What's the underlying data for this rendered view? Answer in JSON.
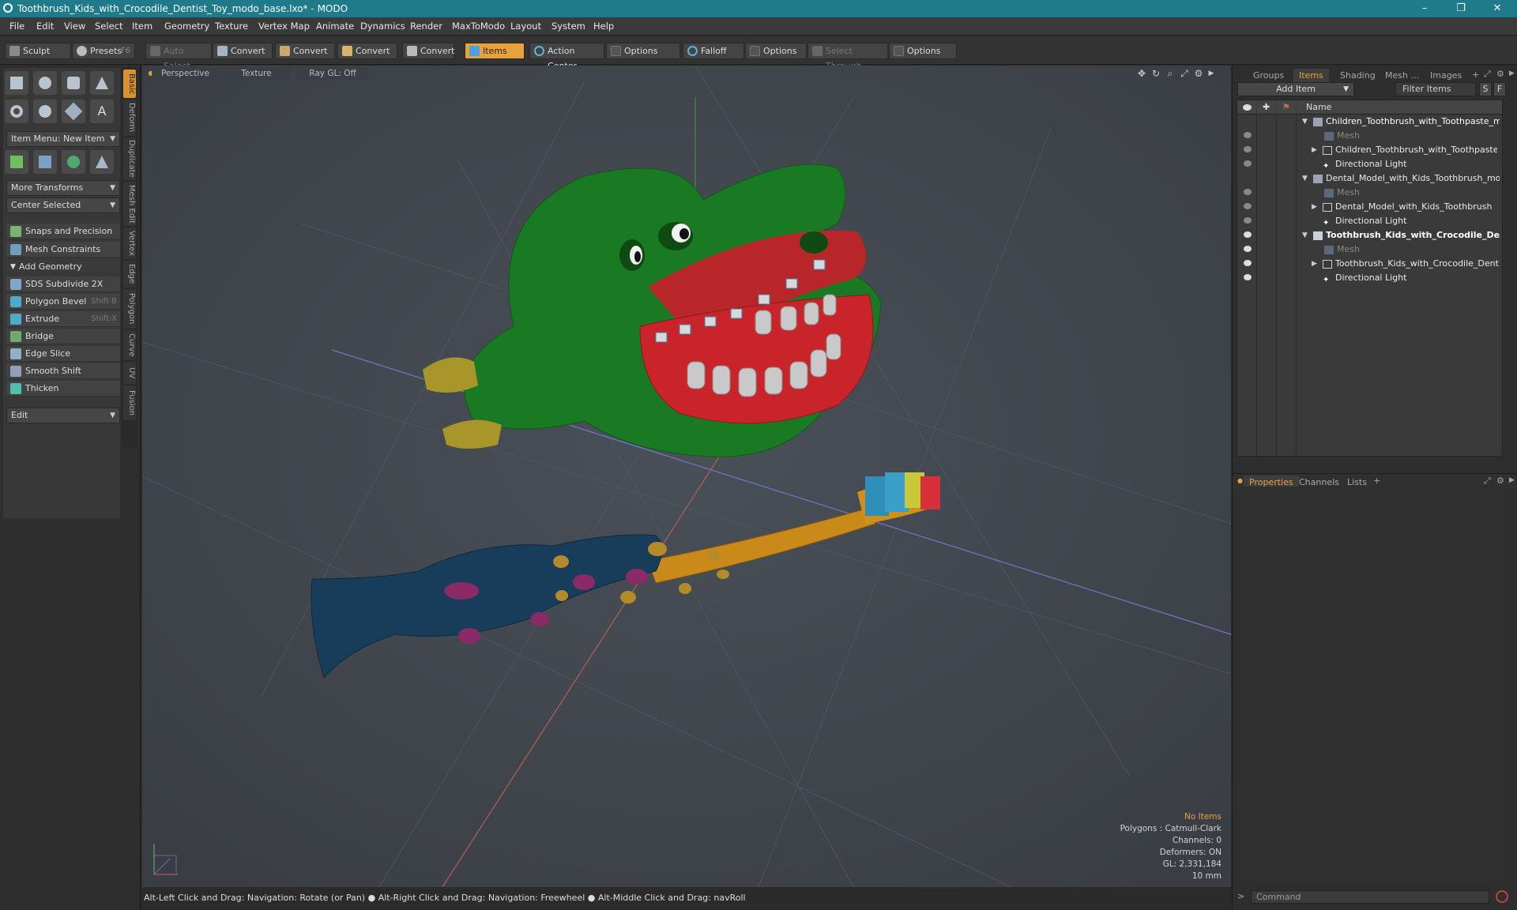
{
  "window": {
    "title": "Toothbrush_Kids_with_Crocodile_Dentist_Toy_modo_base.lxo* - MODO",
    "minimize": "–",
    "maximize": "❐",
    "close": "✕"
  },
  "menu": [
    "File",
    "Edit",
    "View",
    "Select",
    "Item",
    "Geometry",
    "Texture",
    "Vertex Map",
    "Animate",
    "Dynamics",
    "Render",
    "MaxToModo",
    "Layout",
    "System",
    "Help"
  ],
  "toolbar": {
    "sculpt": "Sculpt",
    "presets": "Presets",
    "presets_shortcut": "F6",
    "auto_select": "Auto Select",
    "convert1": "Convert",
    "convert2": "Convert",
    "convert3": "Convert",
    "convert4": "Convert",
    "items": "Items",
    "action_center": "Action Center",
    "options1": "Options",
    "falloff": "Falloff",
    "options2": "Options",
    "select_through": "Select Through",
    "options3": "Options"
  },
  "left": {
    "item_menu": "Item Menu: New Item",
    "more_transforms": "More Transforms",
    "center_selected": "Center Selected",
    "snaps": "Snaps and Precision",
    "mesh_constraints": "Mesh Constraints",
    "add_geometry": "Add Geometry",
    "tools": [
      {
        "label": "SDS Subdivide 2X",
        "shortcut": ""
      },
      {
        "label": "Polygon Bevel",
        "shortcut": "Shift-B"
      },
      {
        "label": "Extrude",
        "shortcut": "Shift-X"
      },
      {
        "label": "Bridge",
        "shortcut": ""
      },
      {
        "label": "Edge Slice",
        "shortcut": ""
      },
      {
        "label": "Smooth Shift",
        "shortcut": ""
      },
      {
        "label": "Thicken",
        "shortcut": ""
      }
    ],
    "edit": "Edit"
  },
  "vtabs": [
    "Basic",
    "Deform",
    "Duplicate",
    "Mesh Edit",
    "Vertex",
    "Edge",
    "Polygon",
    "Curve",
    "UV",
    "Fusion"
  ],
  "viewport": {
    "perspective": "Perspective",
    "texture": "Texture",
    "raygl": "Ray GL: Off",
    "info": {
      "items": "No Items",
      "polygons": "Polygons : Catmull-Clark",
      "channels": "Channels: 0",
      "deformers": "Deformers: ON",
      "gl": "GL: 2,331,184",
      "scale": "10 mm"
    }
  },
  "status": "Alt-Left Click and Drag: Navigation: Rotate (or Pan) ● Alt-Right Click and Drag: Navigation: Freewheel ● Alt-Middle Click and Drag: navRoll",
  "right": {
    "tabs": [
      "Groups",
      "Items",
      "Shading",
      "Mesh ...",
      "Images"
    ],
    "add_item": "Add Item",
    "filter_items": "Filter Items",
    "s_btn": "S",
    "f_btn": "F",
    "name_col": "Name",
    "items": [
      {
        "label": "Children_Toothbrush_with_Toothpaste_mo ...",
        "level": 0
      },
      {
        "label": "Mesh",
        "level": 1
      },
      {
        "label": "Children_Toothbrush_with_Toothpaste",
        "level": 1
      },
      {
        "label": "Directional Light",
        "level": 1
      },
      {
        "label": "Dental_Model_with_Kids_Toothbrush_mod ...",
        "level": 0
      },
      {
        "label": "Mesh",
        "level": 1
      },
      {
        "label": "Dental_Model_with_Kids_Toothbrush",
        "level": 1
      },
      {
        "label": "Directional Light",
        "level": 1
      },
      {
        "label": "Toothbrush_Kids_with_Crocodile_De...",
        "level": 0
      },
      {
        "label": "Mesh",
        "level": 1
      },
      {
        "label": "Toothbrush_Kids_with_Crocodile_Dentist...",
        "level": 1
      },
      {
        "label": "Directional Light",
        "level": 1
      }
    ],
    "bottom_tabs": [
      "Properties",
      "Channels",
      "Lists"
    ],
    "command_placeholder": "Command"
  }
}
